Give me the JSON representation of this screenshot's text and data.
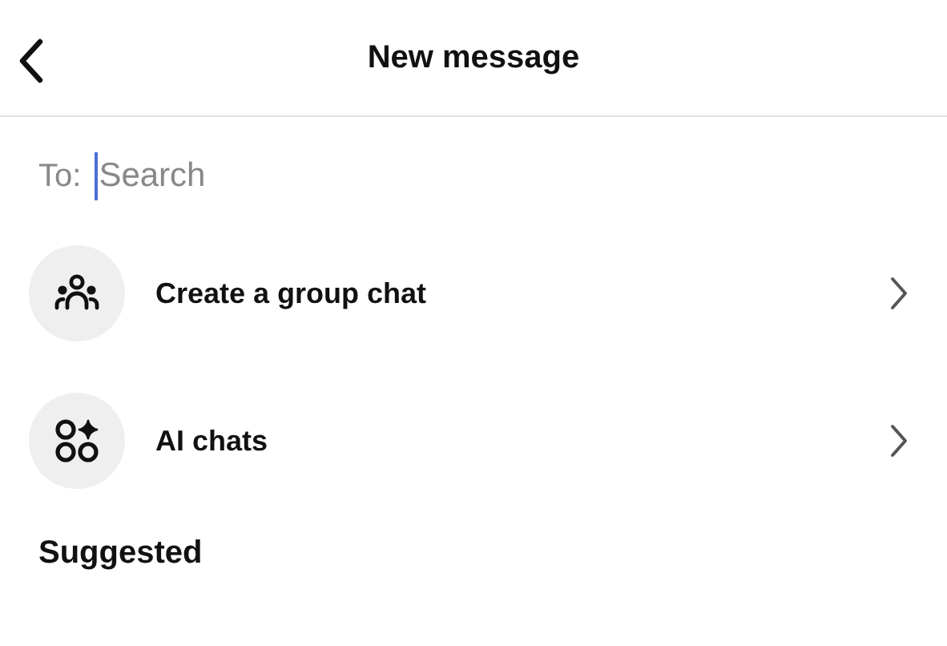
{
  "header": {
    "title": "New message"
  },
  "recipient": {
    "label": "To:",
    "placeholder": "Search"
  },
  "options": [
    {
      "kind": "group",
      "label": "Create a group chat"
    },
    {
      "kind": "ai",
      "label": "AI chats"
    }
  ],
  "section": {
    "title": "Suggested"
  }
}
